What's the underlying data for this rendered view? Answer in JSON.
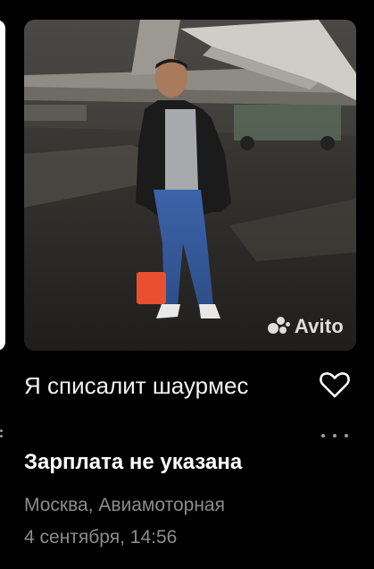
{
  "listing": {
    "title": "Я списалит шаурмес",
    "salary": "Зарплата не указана",
    "location": "Москва, Авиамоторная",
    "date": "4 сентября, 14:56",
    "watermark": "Avito"
  },
  "icons": {
    "favorite": "heart-outline-icon",
    "more": "more-dots-icon",
    "watermark_logo": "avito-logo-icon"
  },
  "colors": {
    "background": "#000000",
    "title_text": "#f2f2f2",
    "secondary_text": "#8c8c8c",
    "accent_orange": "#e8502f"
  }
}
